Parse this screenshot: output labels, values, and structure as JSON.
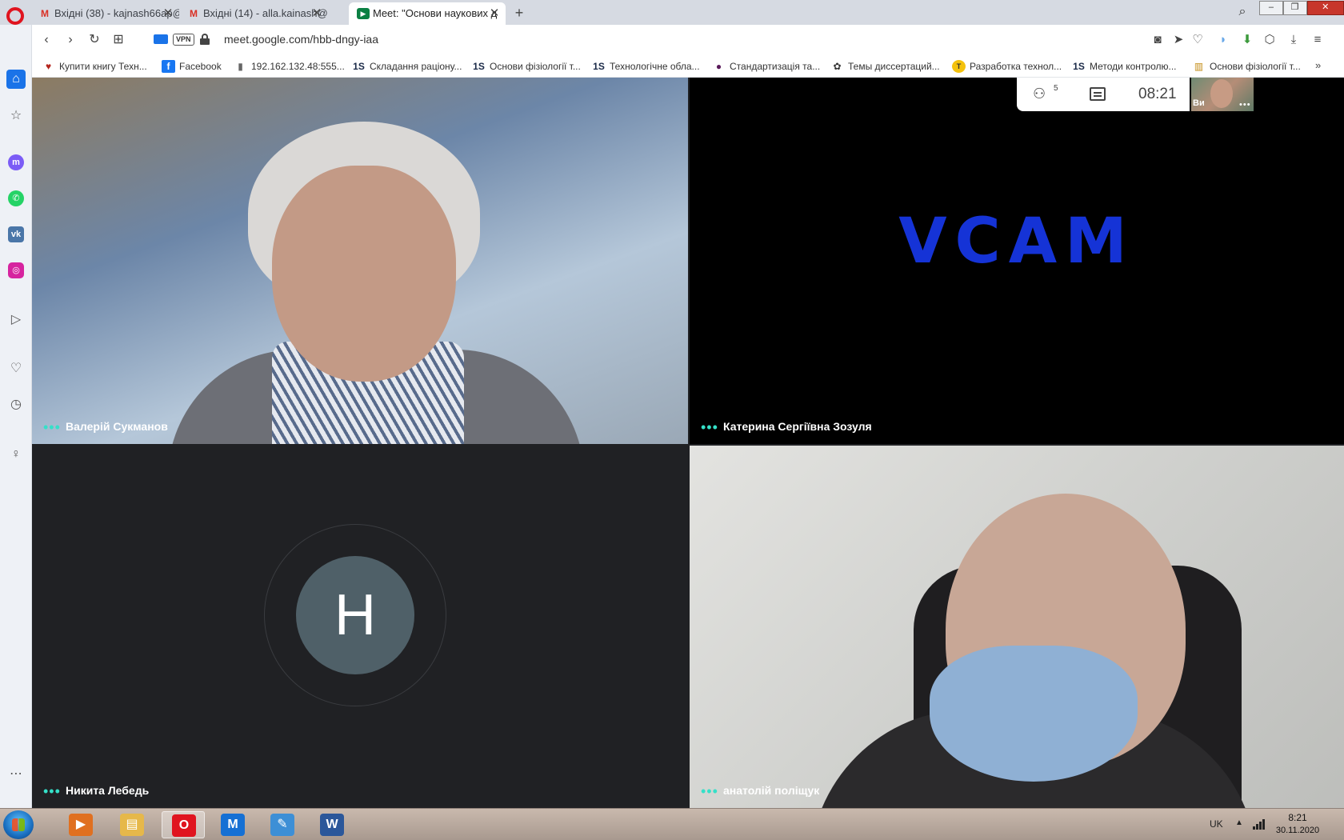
{
  "browser": {
    "tabs": [
      {
        "label": "Вхідні (38) - kajnash66ap@",
        "icon": "gmail-icon",
        "active": false
      },
      {
        "label": "Вхідні (14) - alla.kainash@",
        "icon": "gmail-icon",
        "active": false
      },
      {
        "label": "Meet: \"Основи наукових д",
        "icon": "meet-icon",
        "active": true
      }
    ],
    "url": "meet.google.com/hbb-dngy-iaa",
    "vpn_label": "VPN",
    "new_tab_symbol": "+",
    "close_symbol": "✕",
    "bookmarks": [
      {
        "label": "Купити книгу Техн...",
        "icon": "book-icon"
      },
      {
        "label": "Facebook",
        "icon": "facebook-icon"
      },
      {
        "label": "192.162.132.48:555...",
        "icon": "page-icon"
      },
      {
        "label": "Складання раціону...",
        "icon": "1s-icon"
      },
      {
        "label": "Основи фізіології т...",
        "icon": "1s-icon"
      },
      {
        "label": "Технологічне обла...",
        "icon": "1s-icon"
      },
      {
        "label": "Стандартизація та...",
        "icon": "circle-icon"
      },
      {
        "label": "Темы диссертаций...",
        "icon": "paw-icon"
      },
      {
        "label": "Разработка технол...",
        "icon": "t-icon"
      },
      {
        "label": "Методи контролю...",
        "icon": "1s-icon"
      },
      {
        "label": "Основи фізіології т...",
        "icon": "library-icon"
      }
    ],
    "bookmark_overflow": "»",
    "favicon_text": {
      "gmail": "M",
      "meet": "▶",
      "onec": "1S",
      "facebook": "f",
      "t": "T"
    }
  },
  "meet": {
    "participants": [
      {
        "name": "Валерій Сукманов",
        "kind": "video"
      },
      {
        "name": "Катерина Сергіївна Зозуля",
        "kind": "video",
        "overlay_text": "VCAM"
      },
      {
        "name": "Никита Лебедь",
        "kind": "avatar",
        "initial": "Н"
      },
      {
        "name": "анатолій поліщук",
        "kind": "video"
      }
    ],
    "people_count": "5",
    "clock": "08:21",
    "self_label": "Ви",
    "more_symbol": "•••"
  },
  "taskbar": {
    "apps": [
      {
        "name": "media-player",
        "glyph": "▶",
        "color": "#e07020"
      },
      {
        "name": "file-explorer",
        "glyph": "▤",
        "color": "#e6b84a"
      },
      {
        "name": "opera",
        "glyph": "O",
        "color": "#e0141f"
      },
      {
        "name": "messenger-m",
        "glyph": "M",
        "color": "#1570d4"
      },
      {
        "name": "paint",
        "glyph": "✎",
        "color": "#3d8fd6"
      },
      {
        "name": "word",
        "glyph": "W",
        "color": "#2b579a"
      }
    ],
    "language": "UK",
    "time": "8:21",
    "date": "30.11.2020"
  },
  "colors": {
    "accent": "#1a73e8",
    "meet_dots": "#35e0c8",
    "vcam_blue": "#1533d6",
    "avatar_bg": "#4f6068"
  }
}
